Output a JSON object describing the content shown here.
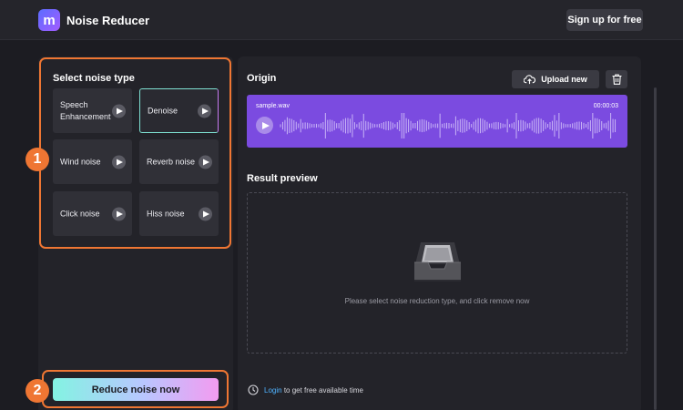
{
  "app": {
    "logo_letter": "m",
    "title": "Noise Reducer",
    "signup_label": "Sign up for free"
  },
  "noise_panel": {
    "title": "Select noise type",
    "types": [
      {
        "label": "Speech Enhancement",
        "selected": false
      },
      {
        "label": "Denoise",
        "selected": true
      },
      {
        "label": "Wind noise",
        "selected": false
      },
      {
        "label": "Reverb noise",
        "selected": false
      },
      {
        "label": "Click noise",
        "selected": false
      },
      {
        "label": "Hiss noise",
        "selected": false
      }
    ],
    "reduce_label": "Reduce noise now"
  },
  "annotations": {
    "badge_1": "1",
    "badge_2": "2",
    "highlight_color": "#ef7633"
  },
  "origin": {
    "title": "Origin",
    "upload_label": "Upload new",
    "file_name": "sample.wav",
    "duration": "00:00:03",
    "card_color": "#7b4be0"
  },
  "result": {
    "title": "Result preview",
    "empty_message": "Please select noise reduction type, and click remove now"
  },
  "footer": {
    "login_link": "Login",
    "login_suffix": "to get free available time"
  },
  "icons": [
    "play-icon",
    "upload-cloud-icon",
    "trash-icon",
    "empty-tray-icon",
    "clock-icon"
  ]
}
